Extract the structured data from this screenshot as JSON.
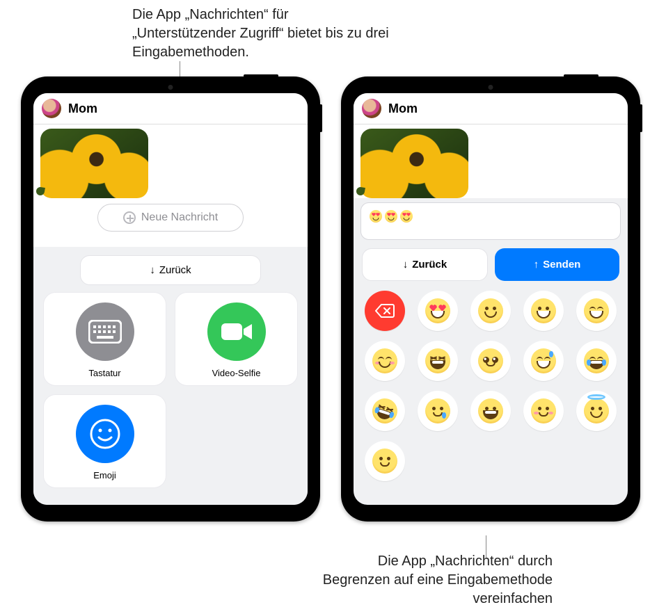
{
  "callouts": {
    "top": "Die App „Nachrichten“ für „Unterstützender Zugriff“ bietet bis zu drei Eingabemethoden.",
    "bottom": "Die App „Nachrichten“ durch Begrenzen auf eine Eingabemethode vereinfachen"
  },
  "left": {
    "contact": "Mom",
    "compose_placeholder": "Neue Nachricht",
    "back_label": "Zurück",
    "methods": {
      "keyboard": "Tastatur",
      "video": "Video-Selfie",
      "emoji": "Emoji"
    }
  },
  "right": {
    "contact": "Mom",
    "compose_value_desc": "heart-eyes heart-eyes heart-eyes",
    "back_label": "Zurück",
    "send_label": "Senden",
    "emoji_names": [
      "delete",
      "heart-eyes",
      "smile",
      "grin-big",
      "beaming",
      "blush-smile",
      "xd-squint",
      "pleading",
      "sweat-smile",
      "tears-of-joy",
      "rofl",
      "crying",
      "grin",
      "slight-smile",
      "halo",
      "neutral-smile"
    ]
  }
}
